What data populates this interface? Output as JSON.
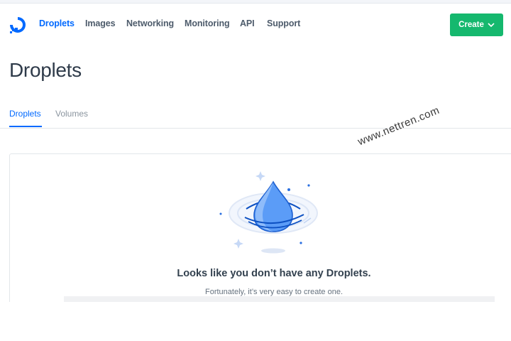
{
  "nav": {
    "items": [
      {
        "label": "Droplets",
        "active": true
      },
      {
        "label": "Images"
      },
      {
        "label": "Networking"
      },
      {
        "label": "Monitoring"
      },
      {
        "label": "API"
      },
      {
        "label": "Support"
      }
    ],
    "create_label": "Create",
    "create_icon": "chevron-down-icon",
    "logo_icon": "digitalocean-logo-icon"
  },
  "page": {
    "title": "Droplets",
    "tabs": [
      {
        "label": "Droplets",
        "active": true
      },
      {
        "label": "Volumes"
      }
    ]
  },
  "empty_state": {
    "illustration": "water-drop-illustration",
    "title": "Looks like you don’t have any Droplets.",
    "subtitle": "Fortunately, it’s very easy to create one."
  },
  "watermark": "www.nettren.com",
  "colors": {
    "brand_blue": "#0069ff",
    "create_green": "#15b86e",
    "nav_text": "#4d5b6b"
  }
}
